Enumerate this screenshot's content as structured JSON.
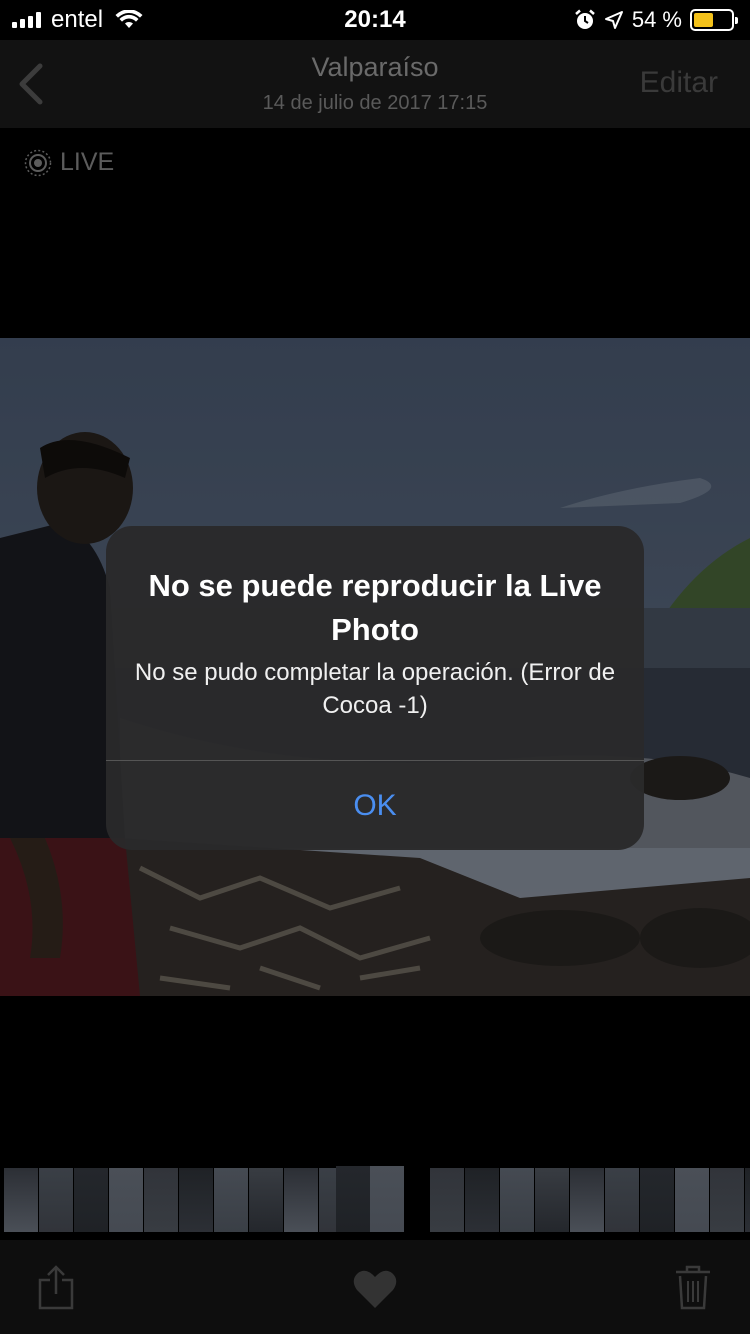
{
  "status_bar": {
    "carrier": "entel",
    "time": "20:14",
    "battery_percent_label": "54 %",
    "battery_level": 0.54,
    "icons": [
      "signal-icon",
      "wifi-icon",
      "alarm-icon",
      "location-icon",
      "battery-icon"
    ]
  },
  "nav": {
    "title": "Valparaíso",
    "subtitle": "14 de julio de 2017 17:15",
    "edit_label": "Editar",
    "back_icon": "chevron-left-icon"
  },
  "live_badge": {
    "label": "LIVE",
    "icon": "live-photo-icon"
  },
  "alert": {
    "title": "No se puede reproducir la Live Photo",
    "message": "No se pudo completar la operación. (Error de Cocoa -1)",
    "ok_label": "OK"
  },
  "toolbar": {
    "icons": [
      "share-icon",
      "heart-icon",
      "trash-icon"
    ]
  },
  "colors": {
    "accent": "#4a8ef0",
    "battery": "#f4c21b",
    "alert_bg": "#2a2a2b"
  }
}
